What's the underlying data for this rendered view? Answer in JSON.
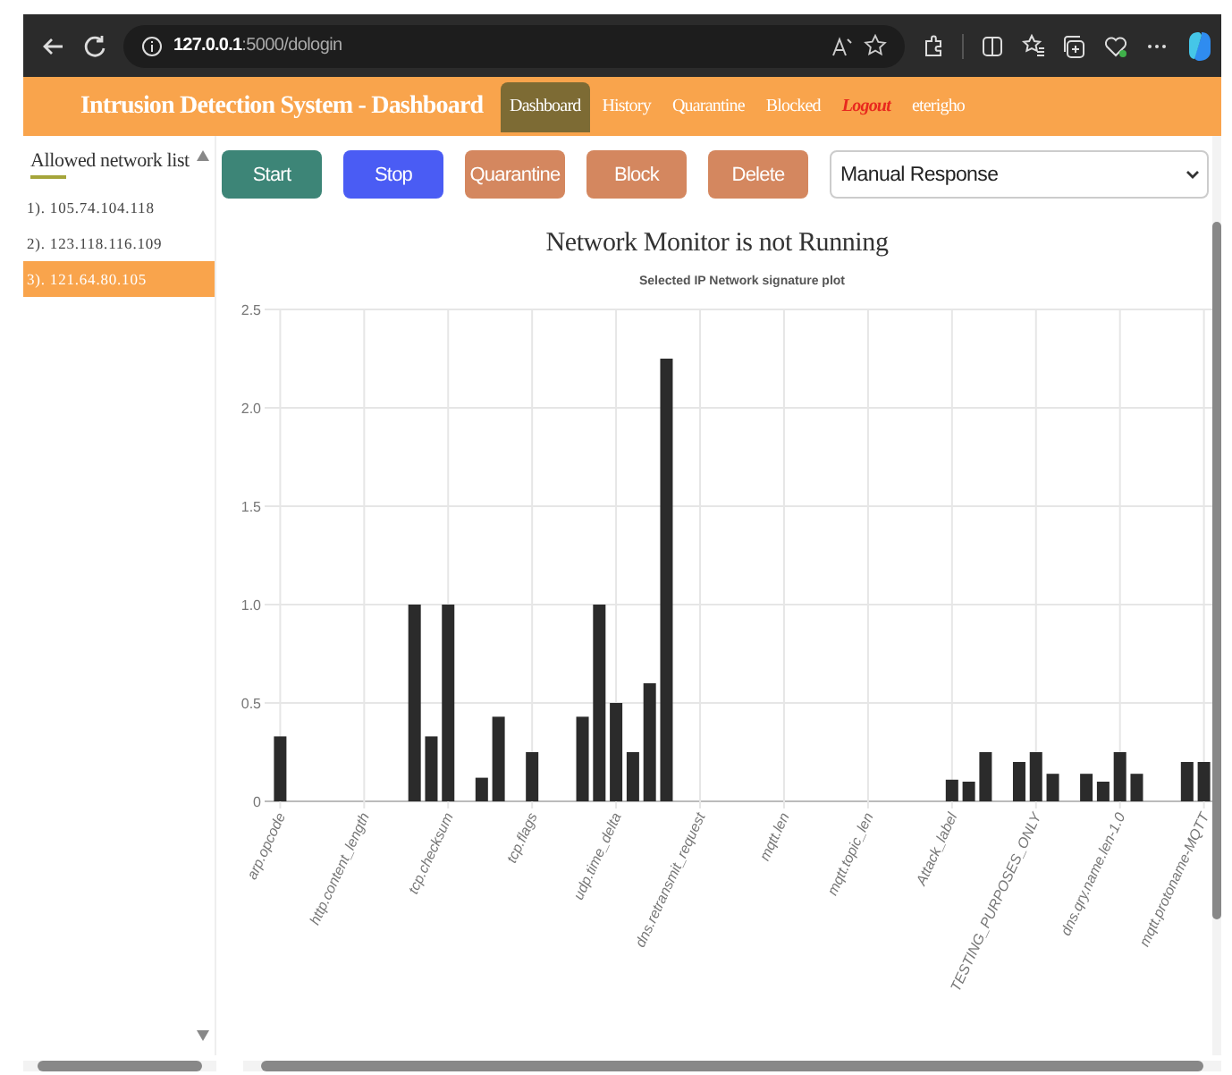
{
  "browser": {
    "url_host": "127.0.0.1",
    "url_rest": ":5000/dologin"
  },
  "header": {
    "title": "Intrusion Detection System - Dashboard",
    "nav": [
      {
        "label": "Dashboard",
        "kind": "link",
        "selected": true
      },
      {
        "label": "History",
        "kind": "link",
        "selected": false
      },
      {
        "label": "Quarantine",
        "kind": "link",
        "selected": false
      },
      {
        "label": "Blocked",
        "kind": "link",
        "selected": false
      },
      {
        "label": "Logout",
        "kind": "logout",
        "selected": false
      },
      {
        "label": "eterigho",
        "kind": "user",
        "selected": false
      }
    ]
  },
  "sidebar": {
    "title": "Allowed network list",
    "items": [
      {
        "label": "1). 105.74.104.118",
        "selected": false
      },
      {
        "label": "2). 123.118.116.109",
        "selected": false
      },
      {
        "label": "3). 121.64.80.105",
        "selected": true
      }
    ]
  },
  "buttons": [
    {
      "label": "Start",
      "color": "#3d8577"
    },
    {
      "label": "Stop",
      "color": "#4a5cf4"
    },
    {
      "label": "Quarantine",
      "color": "#d4875f"
    },
    {
      "label": "Block",
      "color": "#d4875f"
    },
    {
      "label": "Delete",
      "color": "#d4875f"
    }
  ],
  "response_select": {
    "value": "Manual Response"
  },
  "status": "Network Monitor is not Running",
  "chart_data": {
    "type": "bar",
    "title": "Selected IP Network signature plot",
    "ylim": [
      0,
      2.5
    ],
    "grid": true,
    "categories": [
      "arp.opcode",
      null,
      null,
      null,
      null,
      "http.content_length",
      null,
      null,
      null,
      null,
      "tcp.checksum",
      null,
      null,
      null,
      null,
      "tcp.flags",
      null,
      null,
      null,
      null,
      "udp.time_delta",
      null,
      null,
      null,
      null,
      "dns.retransmit_request",
      null,
      null,
      null,
      null,
      "mqtt.len",
      null,
      null,
      null,
      null,
      "mqtt.topic_len",
      null,
      null,
      null,
      null,
      "Attack_label",
      null,
      null,
      null,
      null,
      "TESTING_PURPOSES_ONLY",
      null,
      null,
      null,
      null,
      "dns.qry.name.len-1.0",
      null,
      null,
      null,
      null,
      "mqtt.protoname-MQTT"
    ],
    "values": [
      0.33,
      0,
      0,
      0,
      0,
      0,
      0,
      0,
      1,
      0.33,
      1,
      0,
      0.12,
      0.43,
      0,
      0.25,
      0,
      0,
      0.43,
      1,
      0.5,
      0.25,
      0.6,
      2.25,
      0,
      0,
      0,
      0,
      0,
      0,
      0,
      0,
      0,
      0,
      0,
      0,
      0,
      0,
      0,
      0,
      0.11,
      0.1,
      0.25,
      0,
      0.2,
      0.25,
      0.14,
      0,
      0.14,
      0.1,
      0.25,
      0.14,
      0,
      0,
      0.2,
      0.2
    ],
    "yticks": [
      {
        "value": 0,
        "label": "0"
      },
      {
        "value": 0.5,
        "label": "0.5"
      },
      {
        "value": 1,
        "label": "1.0"
      },
      {
        "value": 1.5,
        "label": "1.5"
      },
      {
        "value": 2,
        "label": "2.0"
      },
      {
        "value": 2.5,
        "label": "2.5"
      }
    ]
  }
}
